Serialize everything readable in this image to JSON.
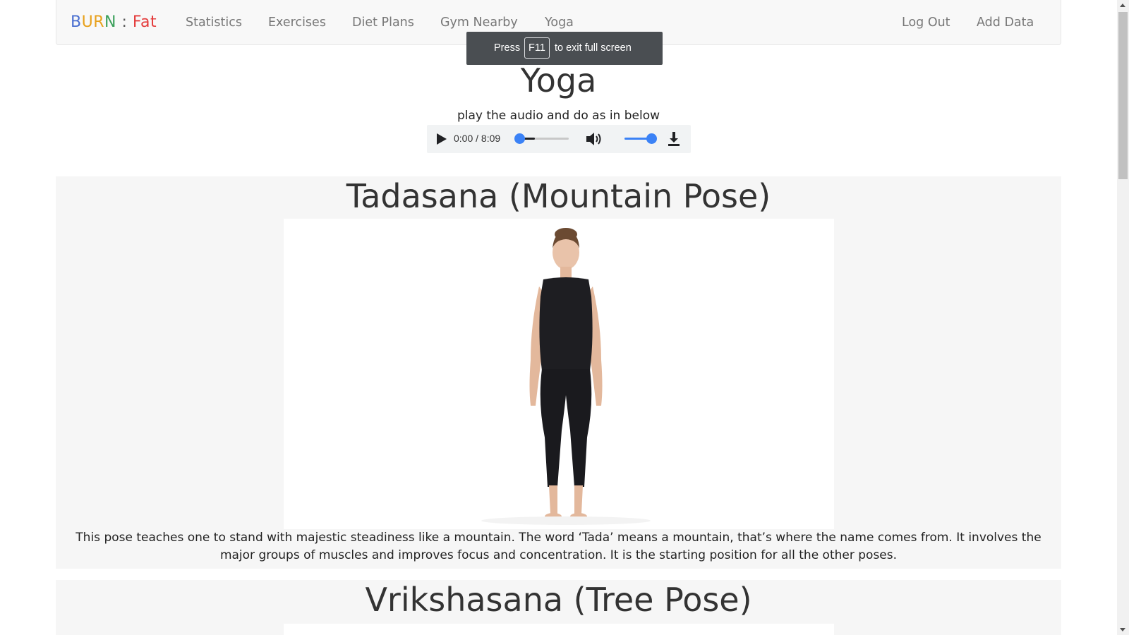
{
  "nav": {
    "brand": {
      "letters": [
        {
          "text": "B",
          "color": "#4a6fd0"
        },
        {
          "text": "U",
          "color": "#e8a11c"
        },
        {
          "text": "R",
          "color": "#e8a11c"
        },
        {
          "text": "N",
          "color": "#3aa05a"
        },
        {
          "text": " : ",
          "color": "#555555"
        },
        {
          "text": "Fat",
          "color": "#e43b3b"
        }
      ]
    },
    "links": [
      "Statistics",
      "Exercises",
      "Diet Plans",
      "Gym Nearby",
      "Yoga"
    ],
    "right_links": [
      "Log Out",
      "Add Data"
    ]
  },
  "fullscreen_toast": {
    "prefix": "Press",
    "key": "F11",
    "suffix": "to exit full screen"
  },
  "page": {
    "title": "Yoga",
    "subtitle": "play the audio and do as in below"
  },
  "audio": {
    "time": "0:00 / 8:09",
    "progress_fraction": 0.0,
    "volume_fraction": 1.0,
    "play_icon": "play-icon",
    "volume_icon": "volume-icon",
    "download_icon": "download-icon"
  },
  "poses": [
    {
      "title": "Tadasana (Mountain Pose)",
      "image": "woman standing in mountain pose",
      "description": "This pose teaches one to stand with majestic steadiness like a mountain. The word ‘Tada’ means a mountain, that’s where the name comes from. It involves the major groups of muscles and improves focus and concentration. It is the starting position for all the other poses."
    },
    {
      "title": "Vrikshasana (Tree Pose)",
      "image": "",
      "description": ""
    }
  ],
  "colors": {
    "navbar_bg": "#f8f8f8",
    "section_bg": "#f6f6f6",
    "accent": "#3b82f6"
  }
}
